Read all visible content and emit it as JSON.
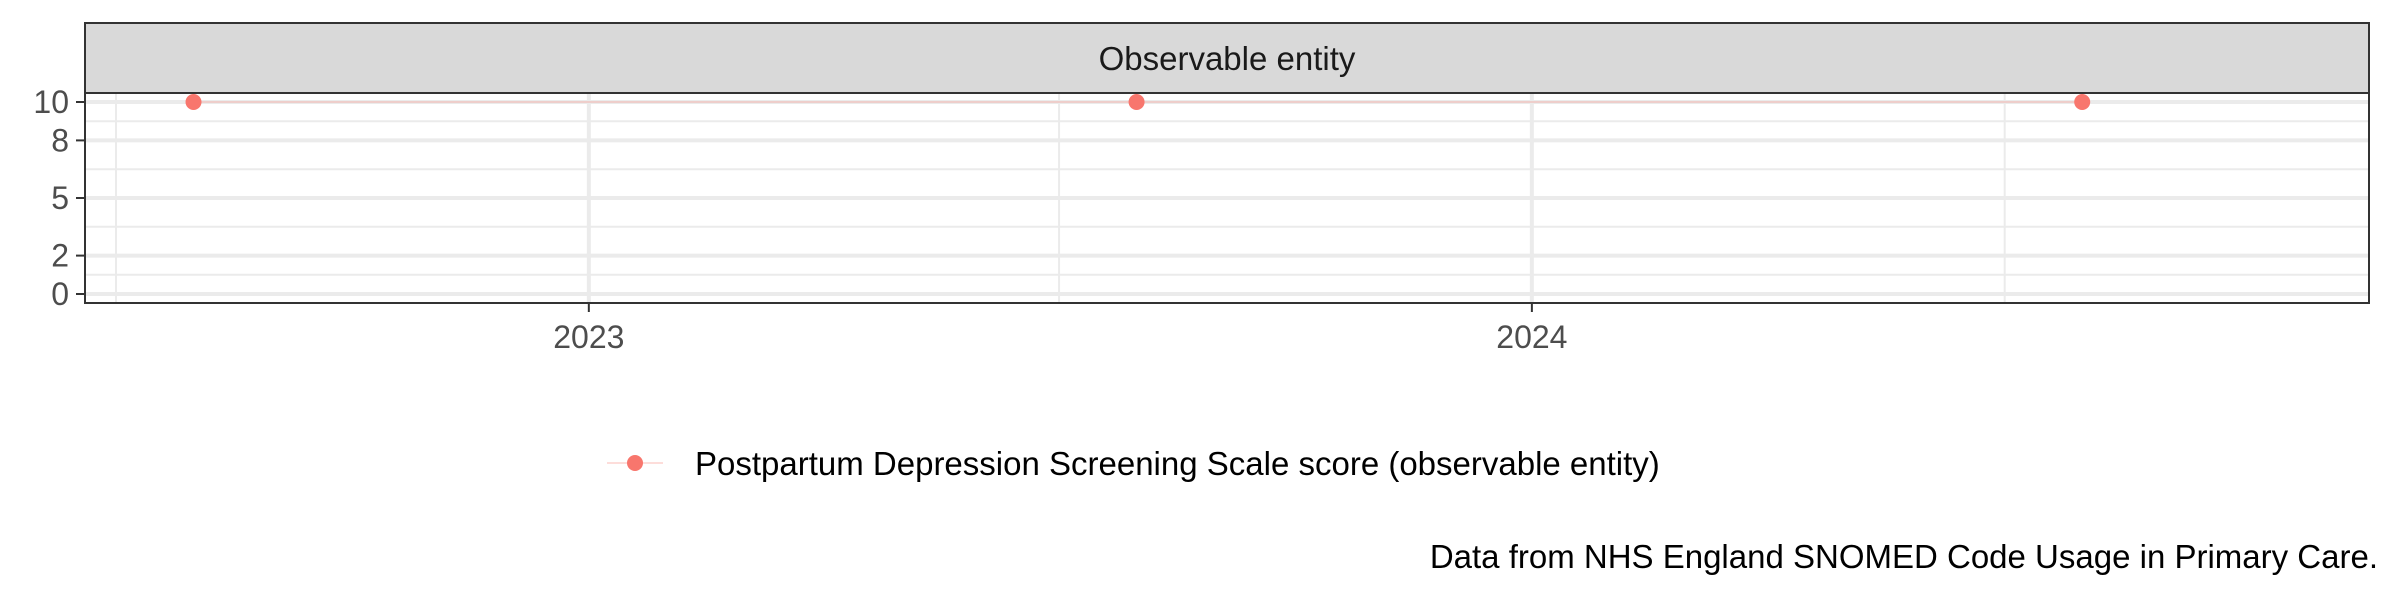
{
  "chart_data": {
    "type": "line",
    "facet": "Observable entity",
    "x_ticks": [
      "2023",
      "2024"
    ],
    "y_ticks": [
      0,
      2,
      5,
      8,
      10
    ],
    "ylim": [
      0,
      10
    ],
    "xlim": [
      "2022-06-20",
      "2024-11-20"
    ],
    "series": [
      {
        "name": "Postpartum Depression Screening Scale score (observable entity)",
        "color": "#F8766D",
        "x": [
          "2022-08-01",
          "2023-08-01",
          "2024-08-01"
        ],
        "y": [
          10,
          10,
          10
        ]
      }
    ],
    "caption": "Data from NHS England SNOMED Code Usage in Primary Care.",
    "grid": true,
    "legend_position": "bottom"
  }
}
